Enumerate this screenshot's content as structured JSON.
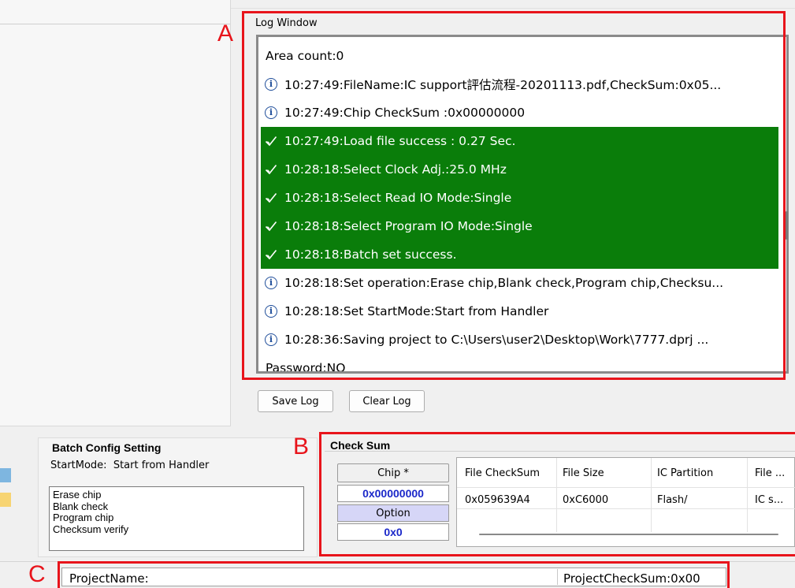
{
  "annotations": {
    "a": "A",
    "b": "B",
    "c": "C"
  },
  "log_window": {
    "title": "Log Window",
    "rows": [
      {
        "kind": "plain",
        "text": "Area count:0"
      },
      {
        "kind": "info",
        "text": "10:27:49:FileName:IC support評估流程-20201113.pdf,CheckSum:0x05..."
      },
      {
        "kind": "info",
        "text": "10:27:49:Chip CheckSum :0x00000000"
      },
      {
        "kind": "success",
        "text": "10:27:49:Load file success : 0.27 Sec."
      },
      {
        "kind": "success",
        "text": "10:28:18:Select Clock Adj.:25.0 MHz"
      },
      {
        "kind": "success",
        "text": "10:28:18:Select Read IO Mode:Single"
      },
      {
        "kind": "success",
        "text": "10:28:18:Select Program IO Mode:Single"
      },
      {
        "kind": "success",
        "text": "10:28:18:Batch set success."
      },
      {
        "kind": "info",
        "text": "10:28:18:Set operation:Erase chip,Blank check,Program chip,Checksu..."
      },
      {
        "kind": "info",
        "text": "10:28:18:Set StartMode:Start from Handler"
      },
      {
        "kind": "info",
        "text": "10:28:36:Saving project to C:\\Users\\user2\\Desktop\\Work\\7777.dprj ..."
      },
      {
        "kind": "plain",
        "text": "Password:NO"
      }
    ],
    "save_label": "Save Log",
    "clear_label": "Clear Log",
    "success_color": "#0a7d0a"
  },
  "batch_config": {
    "title": "Batch Config Setting",
    "start_mode_label": "StartMode:",
    "start_mode_value": "Start from Handler",
    "operations": [
      "Erase chip",
      "Blank check",
      "Program chip",
      "Checksum verify"
    ]
  },
  "check_sum": {
    "title": "Check Sum",
    "chip_label": "Chip *",
    "chip_value": "0x00000000",
    "option_label": "Option",
    "option_value": "0x0",
    "columns": [
      "File CheckSum",
      "File Size",
      "IC Partition",
      "File ..."
    ],
    "row": [
      "0x059639A4",
      "0xC6000",
      "Flash/",
      "IC s..."
    ]
  },
  "project": {
    "name_label": "ProjectName:",
    "checksum_label": "ProjectCheckSum:0x00"
  }
}
